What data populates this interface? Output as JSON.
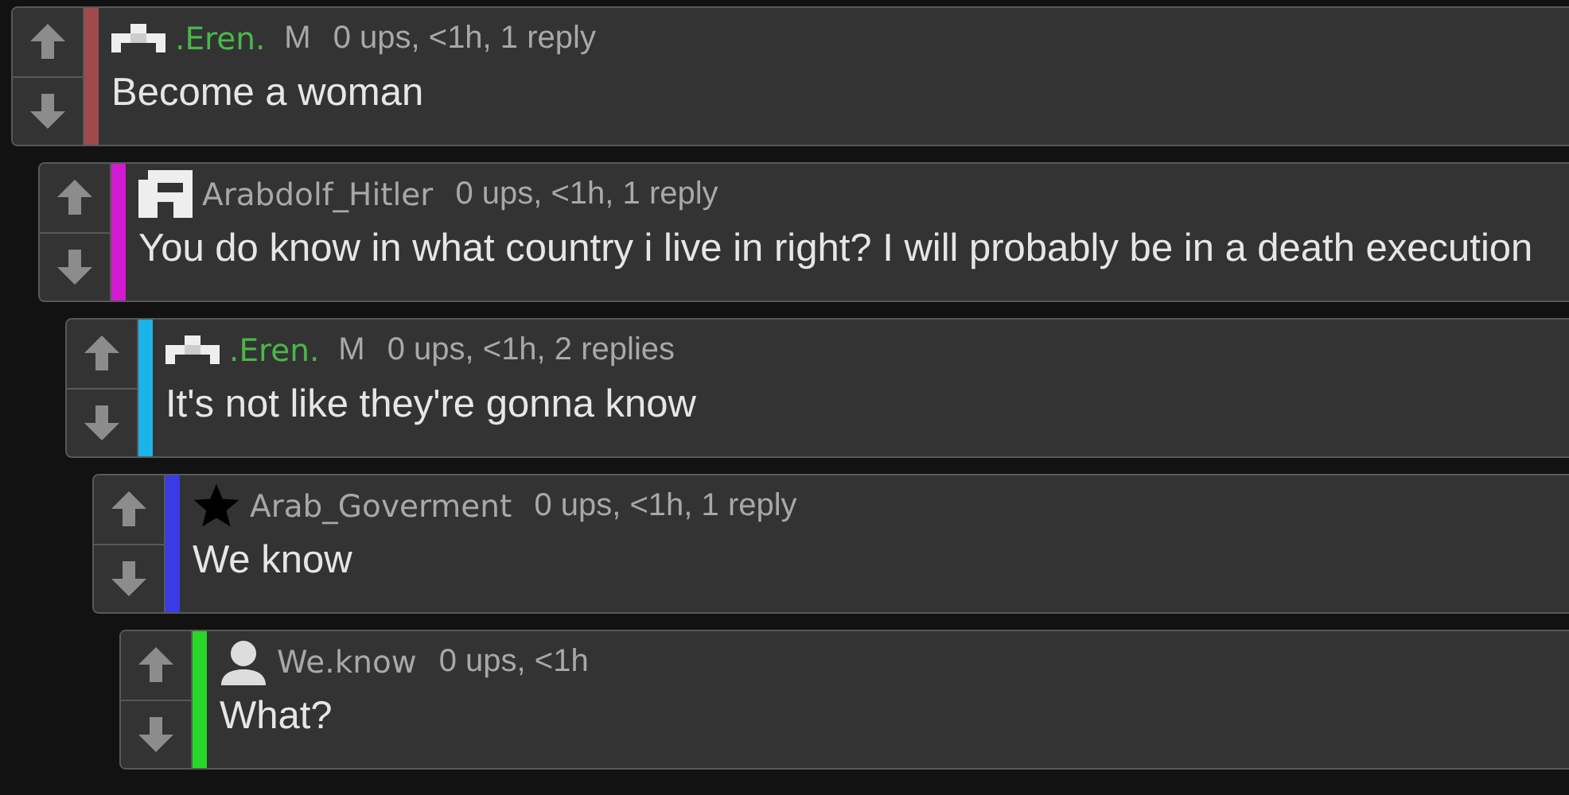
{
  "comments": [
    {
      "avatar": {
        "kind": "pixel-steps"
      },
      "username": ".Eren.",
      "username_highlighted": true,
      "badge": "M",
      "meta": "0 ups, <1h, 1 reply",
      "text": "Become a woman",
      "color": "#a04a4e",
      "children": [
        {
          "avatar": {
            "kind": "pixel-figure"
          },
          "username": "Arabdolf_Hitler",
          "username_highlighted": false,
          "meta": "0 ups, <1h, 1 reply",
          "text": "You do know in what country i live in right? I will probably be in a death execution",
          "color": "#d21ad2",
          "children": [
            {
              "avatar": {
                "kind": "pixel-steps"
              },
              "username": ".Eren.",
              "username_highlighted": true,
              "badge": "M",
              "meta": "0 ups, <1h, 2 replies",
              "text": "It's not like they're gonna know",
              "color": "#1ab4e8",
              "children": [
                {
                  "avatar": {
                    "kind": "star"
                  },
                  "username": "Arab_Goverment",
                  "username_highlighted": false,
                  "meta": "0 ups, <1h, 1 reply",
                  "text": "We know",
                  "color": "#3a3ae8",
                  "children": [
                    {
                      "avatar": {
                        "kind": "person"
                      },
                      "username": "We.know",
                      "username_highlighted": false,
                      "meta": "0 ups, <1h",
                      "text": "What?",
                      "color": "#28d828"
                    }
                  ]
                }
              ]
            }
          ]
        }
      ]
    }
  ]
}
